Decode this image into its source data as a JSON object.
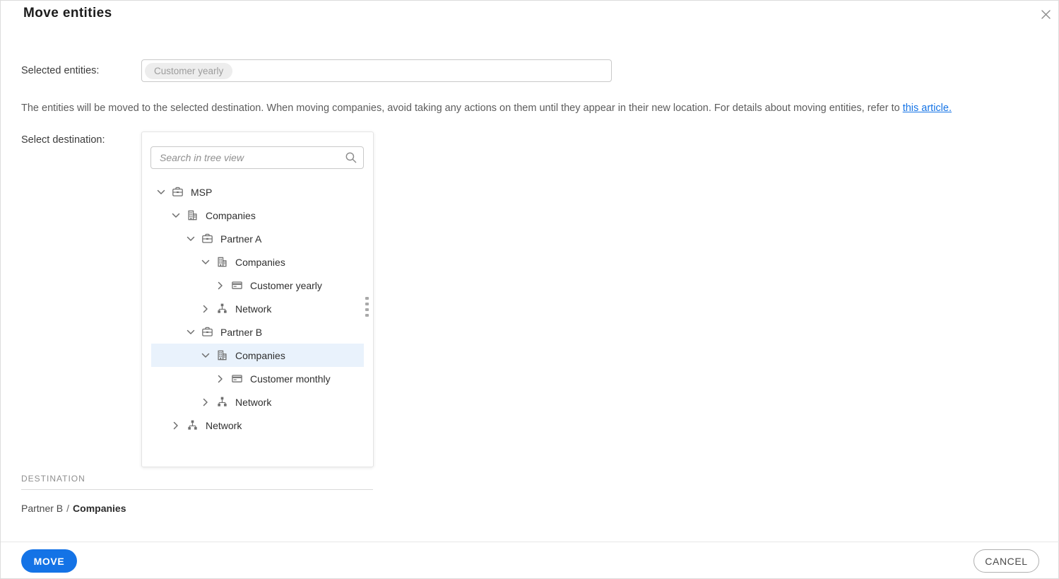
{
  "dialog": {
    "title": "Move entities",
    "close_icon": "close-x"
  },
  "selected_entities": {
    "label": "Selected entities:",
    "chips": [
      "Customer yearly"
    ]
  },
  "description": {
    "text_before_link": "The entities will be moved to the selected destination. When moving companies, avoid taking any actions on them until they appear in their new location. For details about moving entities, refer to ",
    "link_text": "this article."
  },
  "destination_picker": {
    "label": "Select destination:",
    "search": {
      "placeholder": "Search in tree view",
      "icon": "search-icon"
    },
    "tree": [
      {
        "label": "MSP",
        "icon": "partner",
        "level": 0,
        "expanded": true,
        "selected": false
      },
      {
        "label": "Companies",
        "icon": "companies",
        "level": 1,
        "expanded": true,
        "selected": false
      },
      {
        "label": "Partner A",
        "icon": "partner",
        "level": 2,
        "expanded": true,
        "selected": false
      },
      {
        "label": "Companies",
        "icon": "companies",
        "level": 3,
        "expanded": true,
        "selected": false
      },
      {
        "label": "Customer yearly",
        "icon": "customer",
        "level": 4,
        "expanded": false,
        "selected": false
      },
      {
        "label": "Network",
        "icon": "network",
        "level": 3,
        "expanded": false,
        "selected": false
      },
      {
        "label": "Partner B",
        "icon": "partner",
        "level": 2,
        "expanded": true,
        "selected": false
      },
      {
        "label": "Companies",
        "icon": "companies",
        "level": 3,
        "expanded": true,
        "selected": true
      },
      {
        "label": "Customer monthly",
        "icon": "customer",
        "level": 4,
        "expanded": false,
        "selected": false
      },
      {
        "label": "Network",
        "icon": "network",
        "level": 3,
        "expanded": false,
        "selected": false
      },
      {
        "label": "Network",
        "icon": "network",
        "level": 1,
        "expanded": false,
        "selected": false
      }
    ]
  },
  "destination_summary": {
    "heading": "DESTINATION",
    "path_parent": "Partner B",
    "path_separator": "/",
    "path_current": "Companies"
  },
  "footer": {
    "move_label": "MOVE",
    "cancel_label": "CANCEL"
  },
  "colors": {
    "primary": "#1473e6",
    "link": "#1473e6",
    "selected_row_bg": "#e9f2fc"
  }
}
